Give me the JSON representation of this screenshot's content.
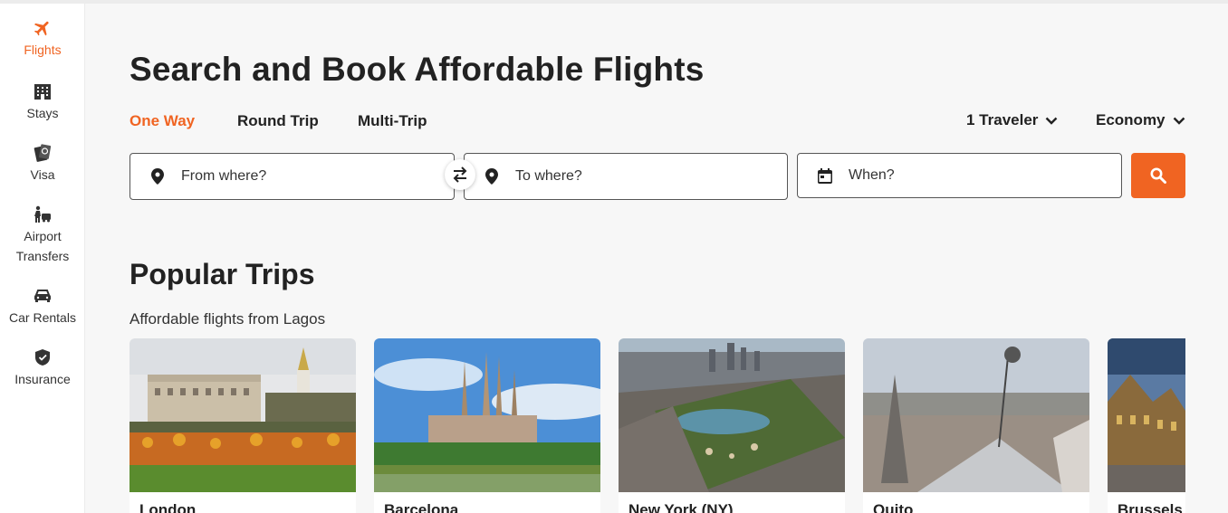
{
  "sidebar": {
    "items": [
      {
        "label": "Flights",
        "icon": "plane-icon",
        "active": true
      },
      {
        "label": "Stays",
        "icon": "building-icon"
      },
      {
        "label": "Visa",
        "icon": "passport-icon"
      },
      {
        "label": "Airport\nTransfers",
        "icon": "traveler-icon"
      },
      {
        "label": "Car Rentals",
        "icon": "car-icon"
      },
      {
        "label": "Insurance",
        "icon": "shield-icon"
      }
    ]
  },
  "header": {
    "title": "Search and Book Affordable Flights"
  },
  "trip_types": [
    "One Way",
    "Round Trip",
    "Multi-Trip"
  ],
  "travelers": "1 Traveler",
  "cabin": "Economy",
  "search": {
    "from_placeholder": "From where?",
    "to_placeholder": "To where?",
    "date_placeholder": "When?"
  },
  "popular": {
    "title": "Popular Trips",
    "subtitle": "Affordable flights from Lagos",
    "cards": [
      "London",
      "Barcelona",
      "New York (NY)",
      "Quito",
      "Brussels"
    ]
  },
  "colors": {
    "accent": "#f06422",
    "text": "#222222",
    "background": "#f7f7f7"
  }
}
